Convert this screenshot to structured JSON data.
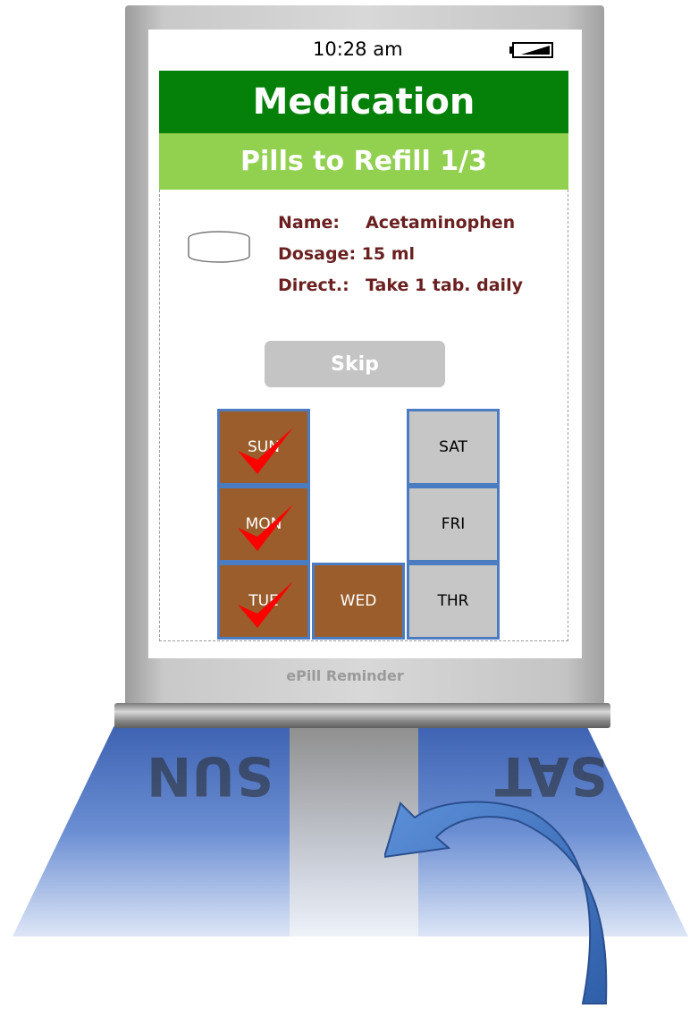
{
  "status": {
    "time": "10:28 am"
  },
  "app": {
    "title": "Medication",
    "subtitle": "Pills to Refill  1/3"
  },
  "medication": {
    "name_label": "Name:",
    "name_value": "Acetaminophen",
    "dosage_label": "Dosage:",
    "dosage_value": "15 ml",
    "direction_label": "Direct.:",
    "direction_value": "Take 1 tab. daily"
  },
  "skip_label": "Skip",
  "pillbox": {
    "days": [
      {
        "label": "SUN",
        "checked": true
      },
      {
        "label": "MON",
        "checked": true
      },
      {
        "label": "TUE",
        "checked": true
      },
      {
        "label": "WED",
        "checked": false
      },
      {
        "label": "THR",
        "checked": false
      },
      {
        "label": "FRI",
        "checked": false
      },
      {
        "label": "SAT",
        "checked": false
      }
    ]
  },
  "device_brand": "ePill Reminder",
  "colors": {
    "header": "#058109",
    "subheader": "#92d050",
    "info_text": "#6b2020",
    "refilled": "#9a5d2b",
    "empty": "#c6c6c6",
    "check": "#ff0000"
  }
}
